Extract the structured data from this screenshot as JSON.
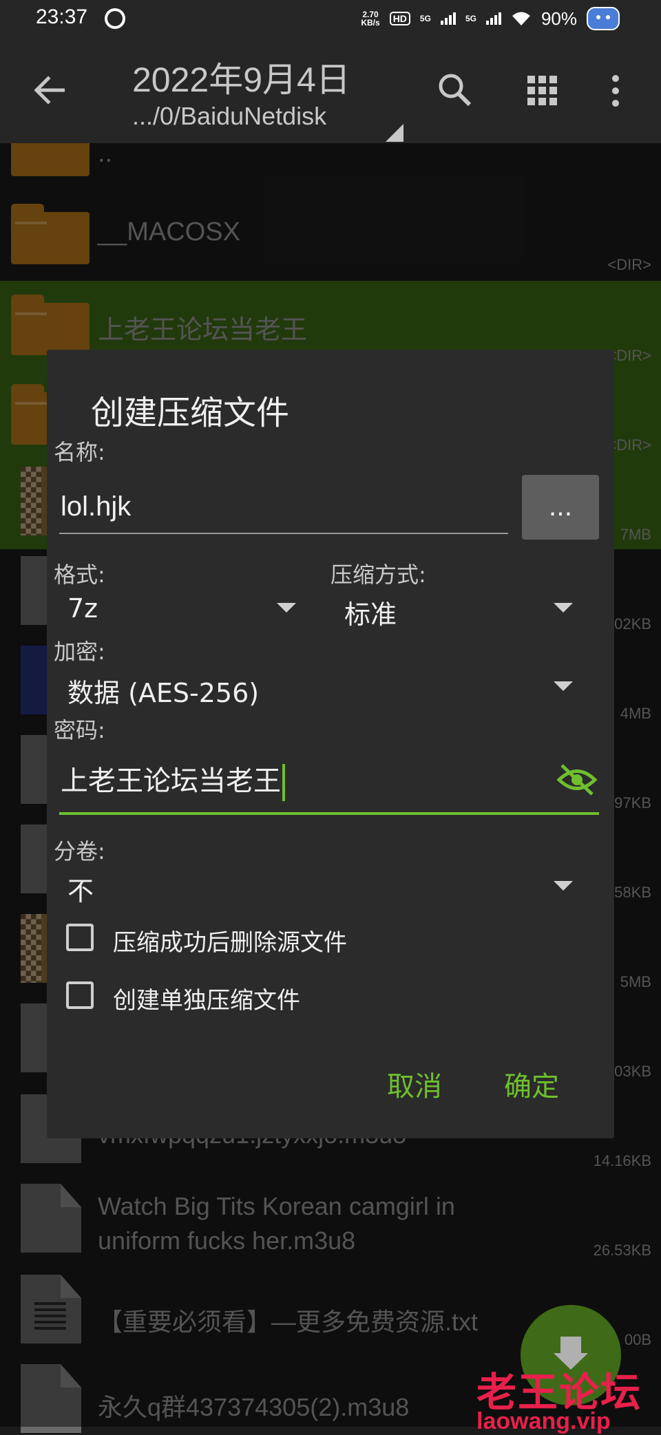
{
  "status_bar": {
    "time": "23:37",
    "net_speed_top": "2.70",
    "net_speed_bottom": "KB/s",
    "hd": "HD",
    "sim1": "5G",
    "sim2": "5G",
    "battery": "90%"
  },
  "app_bar": {
    "title": "2022年9月4日",
    "path": ".../0/BaiduNetdisk"
  },
  "files": [
    {
      "name": "..",
      "meta": ""
    },
    {
      "name": "__MACOSX",
      "meta": "<DIR>"
    },
    {
      "name": "上老王论坛当老王",
      "meta": "<DIR>"
    },
    {
      "name": "",
      "meta": "<DIR>"
    },
    {
      "name": "",
      "meta": "7MB"
    },
    {
      "name": "",
      "meta": "02KB"
    },
    {
      "name": "",
      "meta": "4MB"
    },
    {
      "name": "",
      "meta": "97KB"
    },
    {
      "name": "",
      "meta": "58KB"
    },
    {
      "name": "",
      "meta": "5MB"
    },
    {
      "name": "",
      "meta": "03KB"
    },
    {
      "name": "vmxfwpqqzu1.jztyxxjo.m3u8",
      "meta": "14.16KB"
    },
    {
      "name": "Watch Big Tits Korean camgirl in",
      "name_line2": "uniform fucks her.m3u8",
      "meta": "26.53KB"
    },
    {
      "name": "【重要必须看】—更多免费资源.txt",
      "meta": "00B"
    },
    {
      "name": "永久q群437374305(2).m3u8",
      "meta": ""
    }
  ],
  "dialog": {
    "title": "创建压缩文件",
    "name_label": "名称:",
    "name_value": "lol.hjk",
    "browse_label": "...",
    "format_label": "格式:",
    "format_value": "7z",
    "method_label": "压缩方式:",
    "method_value": "标准",
    "encryption_label": "加密:",
    "encryption_value": "数据 (AES-256)",
    "password_label": "密码:",
    "password_value": "上老王论坛当老王",
    "split_label": "分卷:",
    "split_value": "不",
    "delete_source_label": "压缩成功后删除源文件",
    "separate_label": "创建单独压缩文件",
    "cancel_label": "取消",
    "ok_label": "确定"
  },
  "watermark": {
    "text": "老王论坛",
    "domain": "laowang.vip"
  },
  "colors": {
    "accent": "#6fbf2e",
    "selected_row": "#3d6b16",
    "folder": "#b9781a",
    "watermark": "#e8204b"
  }
}
